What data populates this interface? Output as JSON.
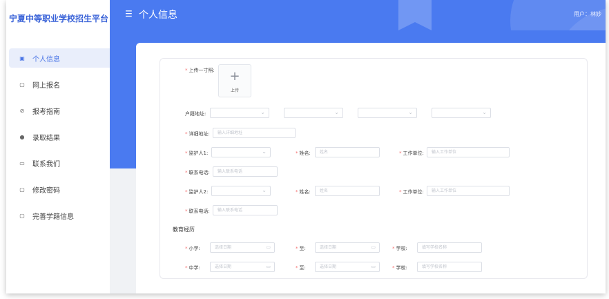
{
  "brand": "宁夏中等职业学校招生平台",
  "header": {
    "title": "个人信息",
    "user": "用户：林妙"
  },
  "menu": [
    {
      "label": "个人信息",
      "icon": "profile-icon",
      "active": true
    },
    {
      "label": "网上报名",
      "icon": "document-icon",
      "active": false
    },
    {
      "label": "报考指南",
      "icon": "compass-icon",
      "active": false
    },
    {
      "label": "录取结果",
      "icon": "person-icon",
      "active": false
    },
    {
      "label": "联系我们",
      "icon": "folder-icon",
      "active": false
    },
    {
      "label": "修改密码",
      "icon": "document-icon",
      "active": false
    },
    {
      "label": "完善学籍信息",
      "icon": "document-icon",
      "active": false
    }
  ],
  "form": {
    "photo_label": "上传一寸照:",
    "upload_text": "上传",
    "household_label": "户籍地址:",
    "address_label": "详细地址:",
    "address_placeholder": "输入详细地址",
    "guardian1_label": "监护人1:",
    "guardian2_label": "监护人2:",
    "name_label": "姓名:",
    "name_placeholder": "姓名",
    "work_label": "工作单位:",
    "work_placeholder": "输入工作单位",
    "phone_label": "联系电话:",
    "phone_placeholder": "输入联系电话",
    "edu_title": "教育经历",
    "primary_label": "小学:",
    "middle_label": "中学:",
    "to_label": "至:",
    "school_label": "学校:",
    "date_placeholder": "选择日期",
    "school_placeholder": "填写学校名称"
  },
  "colors": {
    "primary": "#4a7af0",
    "brand_text": "#3a63d8",
    "required": "#f56c6c"
  }
}
